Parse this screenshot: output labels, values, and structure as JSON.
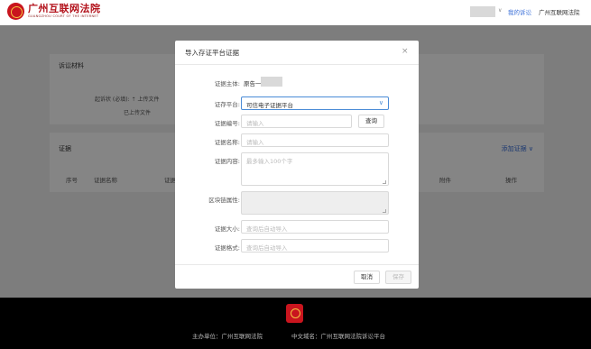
{
  "header": {
    "logo_cn": "广州互联网法院",
    "logo_en": "GUANGZHOU COURT OF THE INTERNET",
    "my_case_label": "我的诉讼",
    "court_label": "广州互联网法院"
  },
  "background": {
    "card1": {
      "title": "诉讼材料",
      "row1": "起诉状 (必填):   ⇡ 上传文件",
      "row2": "已上传文件"
    },
    "card2": {
      "title": "证据",
      "add_label": "添加证据 ∨",
      "columns": [
        "序号",
        "证据名称",
        "证据",
        "附件",
        "操作"
      ]
    }
  },
  "footer": {
    "organizer": "主办单位：广州互联网法院",
    "domain": "中文域名：广州互联网法院诉讼平台"
  },
  "modal": {
    "title": "导入存证平台证据",
    "close_glyph": "×",
    "fields": {
      "party": {
        "label": "证据主体:",
        "value": "原告一"
      },
      "platform": {
        "label": "证存平台:",
        "value": "可信电子证据平台"
      },
      "number": {
        "label": "证据编号:",
        "placeholder": "请输入"
      },
      "query_button": "查询",
      "name": {
        "label": "证据名称:",
        "placeholder": "请输入"
      },
      "content": {
        "label": "证据内容:",
        "placeholder": "最多输入100个字"
      },
      "blockchain": {
        "label": "区块链属性:"
      },
      "size": {
        "label": "证据大小:",
        "placeholder": "查询后自动导入"
      },
      "format": {
        "label": "证据格式:",
        "placeholder": "查询后自动导入"
      }
    },
    "cancel_label": "取消",
    "confirm_label": "保存"
  },
  "colors": {
    "brand_red": "#c9151e",
    "link_blue": "#3a6fd8",
    "select_border": "#4a8bd6"
  }
}
